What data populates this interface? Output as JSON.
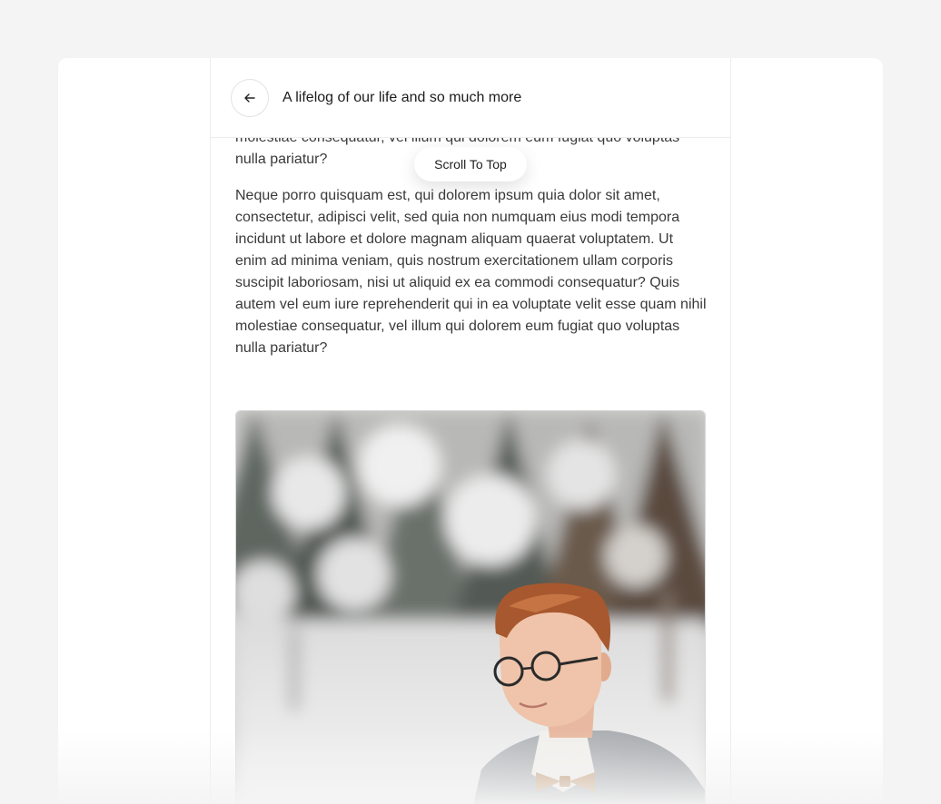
{
  "header": {
    "title": "A lifelog of our life and so much more",
    "back_icon": "arrow-left-icon"
  },
  "scroll_button": {
    "label": "Scroll To Top"
  },
  "article": {
    "paragraphs": [
      "autem vel eum iure reprehenderit qui in ea voluptate velit esse quam nihil molestiae consequatur, vel illum qui dolorem eum fugiat quo voluptas nulla pariatur?",
      "Neque porro quisquam est, qui dolorem ipsum quia dolor sit amet, consectetur, adipisci velit, sed quia non numquam eius modi tempora incidunt ut labore et dolore magnam aliquam quaerat voluptatem. Ut enim ad minima veniam, quis nostrum exercitationem ullam corporis suscipit laboriosam, nisi ut aliquid ex ea commodi consequatur? Quis autem vel eum iure reprehenderit qui in ea voluptate velit esse quam nihil molestiae consequatur, vel illum qui dolorem eum fugiat quo voluptas nulla pariatur?"
    ]
  },
  "colors": {
    "page_bg": "#f4f4f4",
    "card_bg": "#ffffff",
    "text": "#3a3a3a",
    "border": "#ececec"
  }
}
